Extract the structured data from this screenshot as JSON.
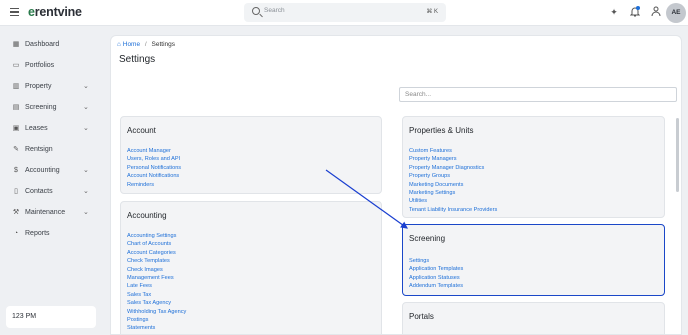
{
  "topbar": {
    "logo_prefix": "e",
    "logo_rest": "rentvine",
    "search_placeholder": "Search",
    "search_shortcut": "⌘ K",
    "avatar_initials": "AE",
    "icons": [
      "menu-icon",
      "sparkle-icon",
      "bell-icon",
      "person-icon"
    ]
  },
  "sidebar": {
    "items": [
      {
        "label": "Dashboard",
        "icon": "grid-icon",
        "glyph": "▦",
        "expandable": false
      },
      {
        "label": "Portfolios",
        "icon": "folder-icon",
        "glyph": "▭",
        "expandable": false
      },
      {
        "label": "Property",
        "icon": "building-icon",
        "glyph": "▥",
        "expandable": true
      },
      {
        "label": "Screening",
        "icon": "document-icon",
        "glyph": "▤",
        "expandable": true
      },
      {
        "label": "Leases",
        "icon": "clipboard-icon",
        "glyph": "▣",
        "expandable": true
      },
      {
        "label": "Rentsign",
        "icon": "signature-icon",
        "glyph": "✎",
        "expandable": false
      },
      {
        "label": "Accounting",
        "icon": "dollar-icon",
        "glyph": "$",
        "expandable": true
      },
      {
        "label": "Contacts",
        "icon": "book-icon",
        "glyph": "▯",
        "expandable": true
      },
      {
        "label": "Maintenance",
        "icon": "wrench-icon",
        "glyph": "⚒",
        "expandable": true
      },
      {
        "label": "Reports",
        "icon": "chart-icon",
        "glyph": "◔",
        "expandable": false
      }
    ],
    "clock": "123 PM"
  },
  "main": {
    "breadcrumb": {
      "home": "Home",
      "separator": "/",
      "current": "Settings"
    },
    "title": "Settings",
    "search_placeholder": "Search...",
    "cards": {
      "account": {
        "title": "Account",
        "links": [
          "Account Manager",
          "Users, Roles and API",
          "Personal Notifications",
          "Account Notifications",
          "Reminders"
        ]
      },
      "accounting": {
        "title": "Accounting",
        "links": [
          "Accounting Settings",
          "Chart of Accounts",
          "Account Categories",
          "Check Templates",
          "Check Images",
          "Management Fees",
          "Late Fees",
          "Sales Tax",
          "Sales Tax Agency",
          "Withholding Tax Agency",
          "Postings",
          "Statements"
        ]
      },
      "properties": {
        "title": "Properties & Units",
        "links": [
          "Custom Features",
          "Property Managers",
          "Property Manager Diagnostics",
          "Property Groups",
          "Marketing Documents",
          "Marketing Settings",
          "Utilities",
          "Tenant Liability Insurance Providers"
        ]
      },
      "screening": {
        "title": "Screening",
        "links": [
          "Settings",
          "Application Templates",
          "Application Statuses",
          "Addendum Templates"
        ]
      },
      "portals": {
        "title": "Portals",
        "links": []
      }
    }
  },
  "colors": {
    "link": "#1d6fd8",
    "highlight_border": "#1a47c8",
    "arrow": "#1a3fd0",
    "brand_green": "#2a7a4b"
  }
}
